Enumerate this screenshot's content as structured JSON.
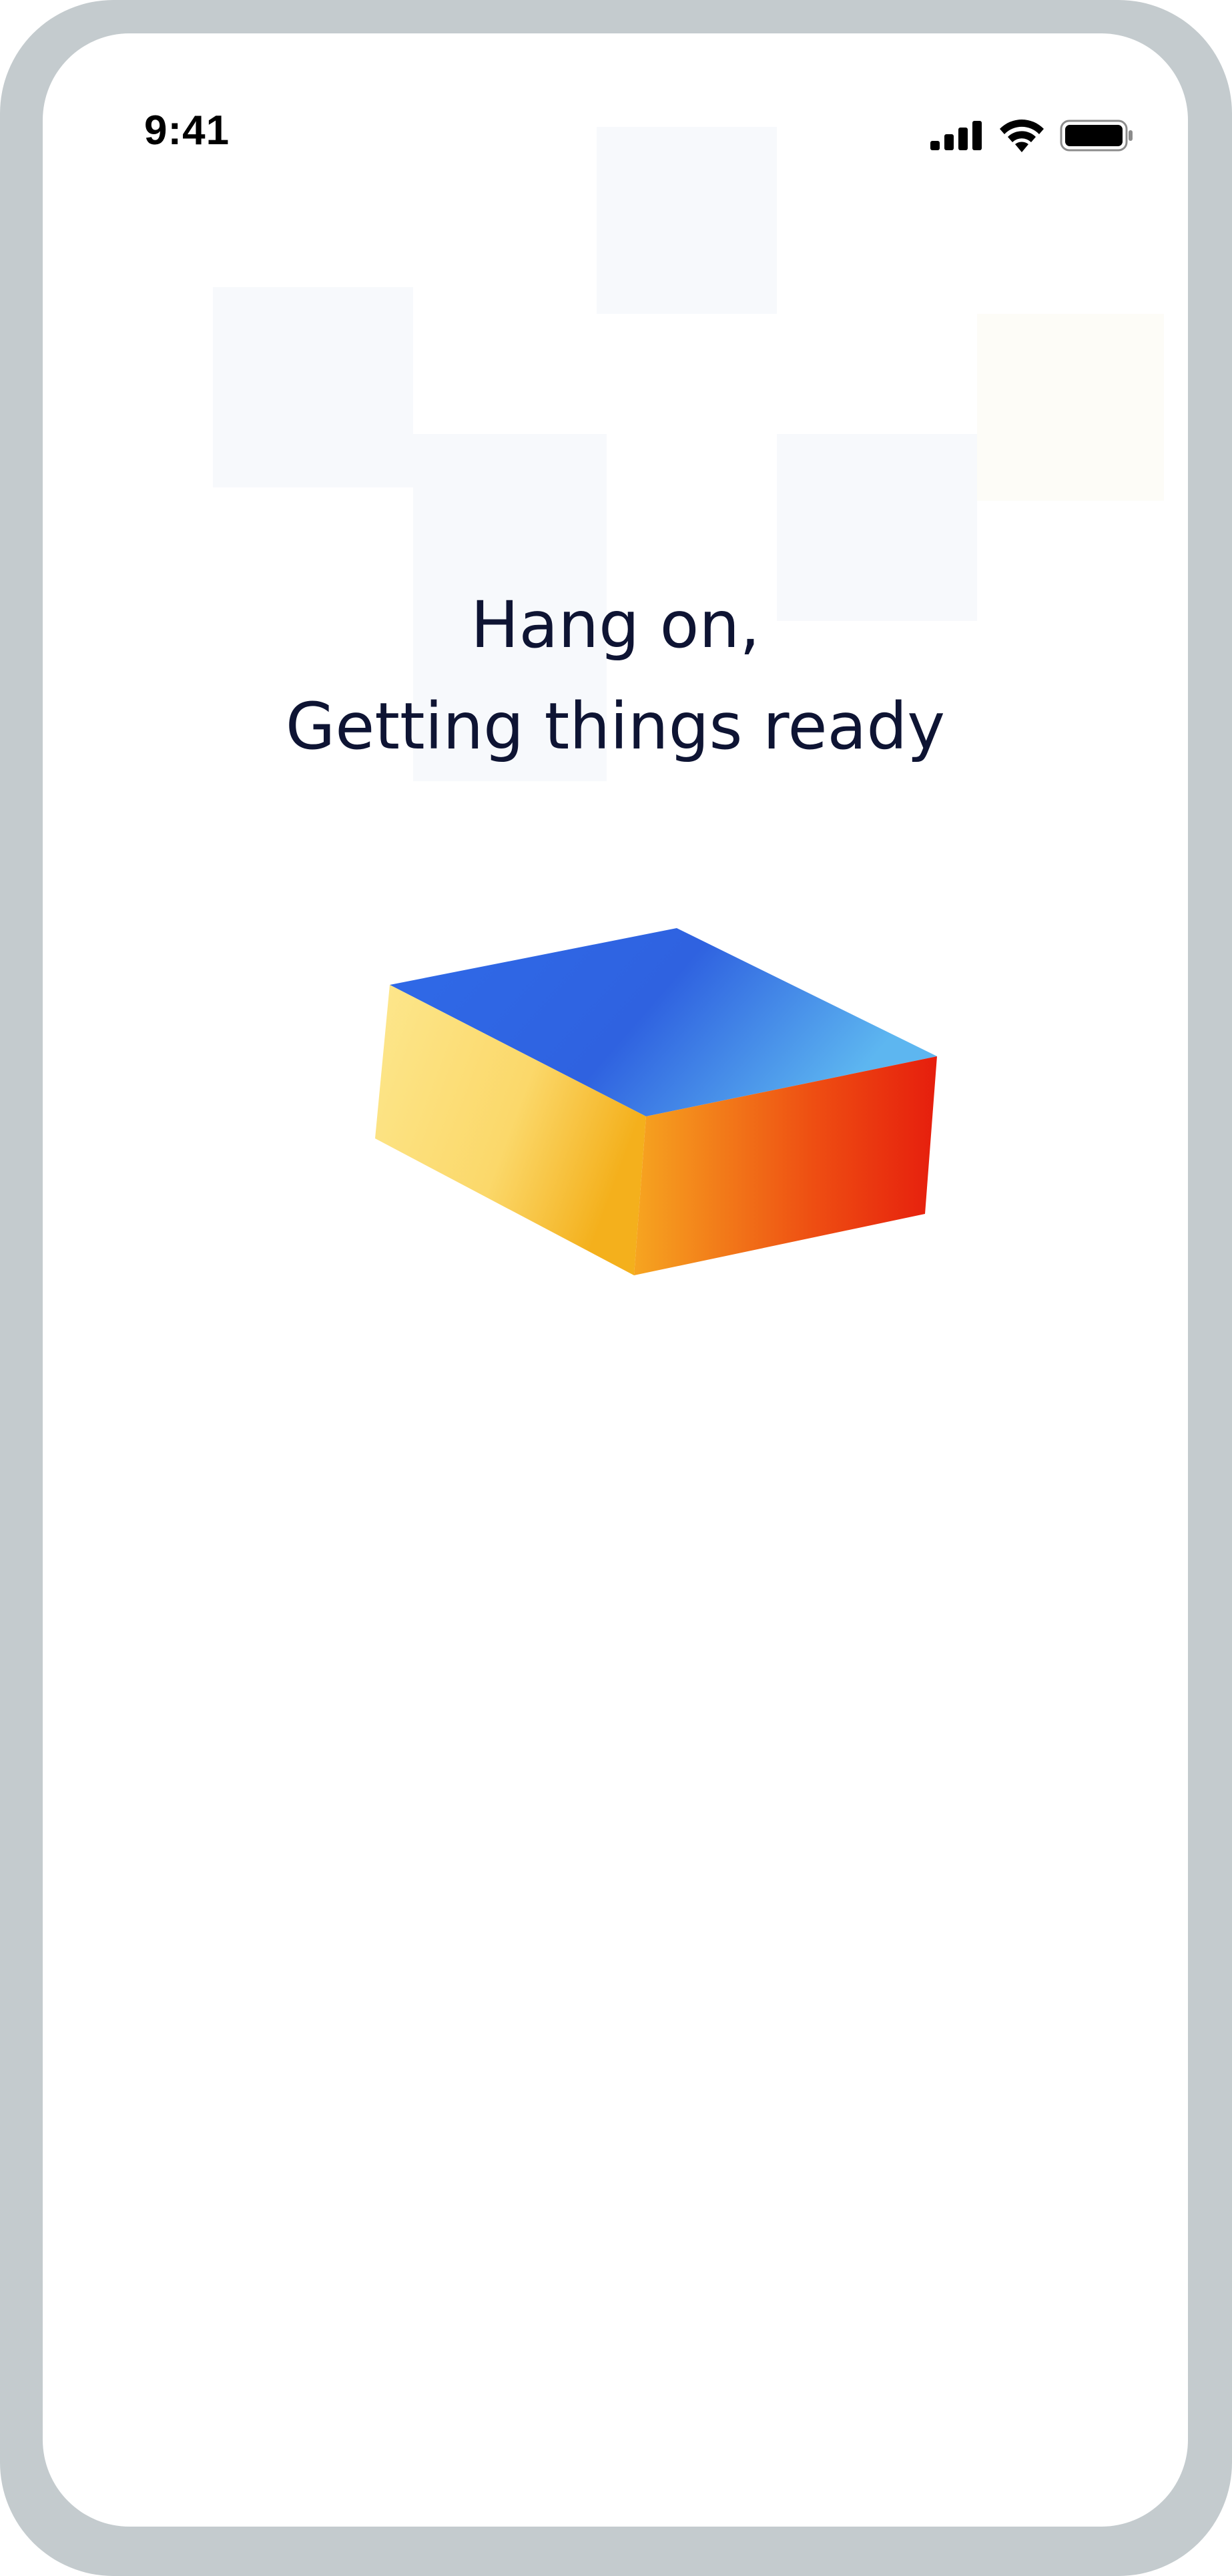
{
  "status_bar": {
    "time": "9:41",
    "icons": [
      "signal-icon",
      "wifi-icon",
      "battery-icon"
    ]
  },
  "loading": {
    "line1": "Hang on,",
    "line2": "Getting things ready"
  },
  "illustration": {
    "name": "loading-box-icon",
    "colors": {
      "top": [
        "#2b64e6",
        "#5ab4f0"
      ],
      "left": [
        "#fde58a",
        "#f5b822"
      ],
      "right": [
        "#f5a021",
        "#e8200e"
      ]
    }
  }
}
